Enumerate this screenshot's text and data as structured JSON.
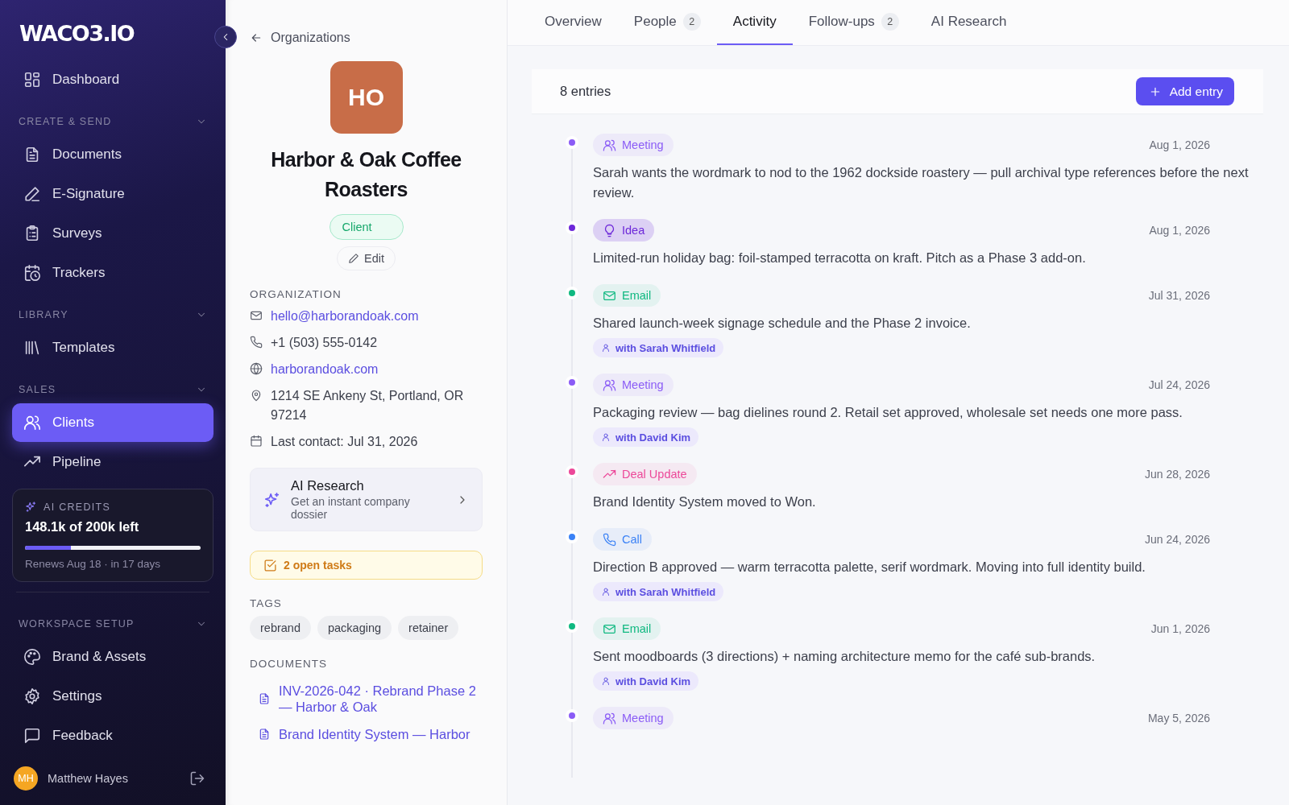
{
  "sidebar": {
    "logo": "WACO3.IO",
    "nav": [
      {
        "kind": "item",
        "label": "Dashboard",
        "selected": false
      },
      {
        "kind": "section",
        "label": "CREATE & SEND",
        "expanded": true
      },
      {
        "kind": "item",
        "label": "Documents",
        "selected": false
      },
      {
        "kind": "item",
        "label": "E-Signature",
        "selected": false
      },
      {
        "kind": "item",
        "label": "Surveys",
        "selected": false
      },
      {
        "kind": "item",
        "label": "Trackers",
        "selected": false
      },
      {
        "kind": "section",
        "label": "LIBRARY",
        "expanded": true
      },
      {
        "kind": "item",
        "label": "Templates",
        "selected": false
      },
      {
        "kind": "section",
        "label": "SALES",
        "expanded": true
      },
      {
        "kind": "item",
        "label": "Clients",
        "selected": true
      },
      {
        "kind": "item",
        "label": "Pipeline",
        "selected": false
      }
    ],
    "credits": {
      "title": "AI CREDITS",
      "value": "148.1k of 200k left",
      "level": 0.26,
      "note": "Renews Aug 18 · in 17 days"
    },
    "workspace_nav": [
      {
        "kind": "section",
        "label": "WORKSPACE SETUP",
        "expanded": true
      },
      {
        "kind": "item",
        "label": "Brand & Assets",
        "selected": false
      },
      {
        "kind": "item",
        "label": "Settings",
        "selected": false
      },
      {
        "kind": "item",
        "label": "Feedback",
        "selected": false
      }
    ],
    "user": {
      "initials": "MH",
      "name": "Matthew Hayes"
    }
  },
  "detail": {
    "back_link": "Organizations",
    "avatar": "HO",
    "name": "Harbor & Oak Coffee Roasters",
    "status": "Client",
    "edit_button": "Edit",
    "organization_heading": "ORGANIZATION",
    "contacts": [
      {
        "kind": "email",
        "text": "hello@harborandoak.com"
      },
      {
        "kind": "phone",
        "text": "+1 (503) 555-0142"
      },
      {
        "kind": "website",
        "text": "harborandoak.com"
      },
      {
        "kind": "address",
        "text": "1214 SE Ankeny St, Portland, OR 97214"
      },
      {
        "kind": "date",
        "text": "Last contact: Jul 31, 2026"
      }
    ],
    "ai_card": {
      "title": "AI Research",
      "subtitle": "Get an instant company dossier"
    },
    "tasks": "2 open tasks",
    "tags_heading": "TAGS",
    "tags": [
      "rebrand",
      "packaging",
      "retainer"
    ],
    "documents_heading": "DOCUMENTS",
    "documents": [
      "INV-2026-042 · Rebrand Phase 2 — Harbor & Oak",
      "Brand Identity System — Harbor"
    ]
  },
  "tabs": [
    {
      "label": "Overview",
      "selected": false
    },
    {
      "label": "People",
      "count": "2",
      "selected": false
    },
    {
      "label": "Activity",
      "selected": true
    },
    {
      "label": "Follow-ups",
      "count": "2",
      "selected": false
    },
    {
      "label": "AI Research",
      "selected": false
    }
  ],
  "activity": {
    "count": "8 entries",
    "add_button": "Add entry",
    "entries": [
      {
        "kind": "meeting",
        "color": "#8b5cf6",
        "label": "Meeting",
        "date": "Aug 1, 2026",
        "text": "Sarah wants the wordmark to nod to the 1962 dockside roastery — pull archival type references before the next review."
      },
      {
        "kind": "idea",
        "color": "#6d28d9",
        "label": "Idea",
        "date": "Aug 1, 2026",
        "text": "Limited-run holiday bag: foil-stamped terracotta on kraft. Pitch as a Phase 3 add-on."
      },
      {
        "kind": "email",
        "color": "#10b981",
        "label": "Email",
        "date": "Jul 31, 2026",
        "text": "Shared launch-week signage schedule and the Phase 2 invoice.",
        "person": "with Sarah Whitfield"
      },
      {
        "kind": "meeting",
        "color": "#8b5cf6",
        "label": "Meeting",
        "date": "Jul 24, 2026",
        "text": "Packaging review — bag dielines round 2. Retail set approved, wholesale set needs one more pass.",
        "person": "with David Kim"
      },
      {
        "kind": "deal",
        "color": "#ec4899",
        "label": "Deal Update",
        "date": "Jun 28, 2026",
        "text": "Brand Identity System moved to Won."
      },
      {
        "kind": "call",
        "color": "#3b82f6",
        "label": "Call",
        "date": "Jun 24, 2026",
        "text": "Direction B approved — warm terracotta palette, serif wordmark. Moving into full identity build.",
        "person": "with Sarah Whitfield"
      },
      {
        "kind": "email",
        "color": "#10b981",
        "label": "Email",
        "date": "Jun 1, 2026",
        "text": "Sent moodboards (3 directions) + naming architecture memo for the café sub-brands.",
        "person": "with David Kim"
      },
      {
        "kind": "meeting",
        "color": "#8b5cf6",
        "label": "Meeting",
        "date": "May 5, 2026"
      }
    ]
  }
}
